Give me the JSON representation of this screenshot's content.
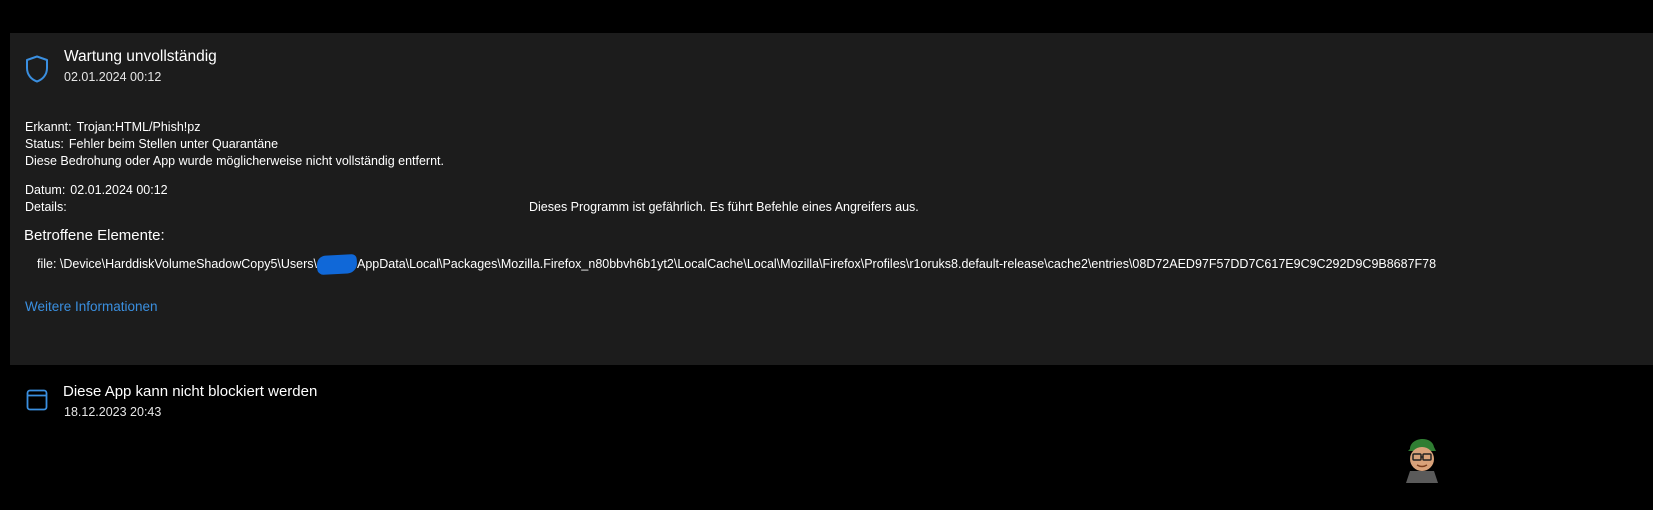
{
  "colors": {
    "background": "#000000",
    "panel": "#1c1c1c",
    "accent": "#3a8fe0",
    "redaction": "#1068d8"
  },
  "threat": {
    "icon": "shield-icon",
    "title": "Wartung unvollständig",
    "timestamp": "02.01.2024 00:12",
    "detected_label": "Erkannt:",
    "detected_value": "Trojan:HTML/Phish!pz",
    "status_label": "Status:",
    "status_value": "Fehler beim Stellen unter Quarantäne",
    "note": "Diese Bedrohung oder App wurde möglicherweise nicht vollständig entfernt.",
    "date_label": "Datum:",
    "date_value": "02.01.2024 00:12",
    "details_label": "Details:",
    "details_value": "Dieses Programm ist gefährlich. Es führt Befehle eines Angreifers aus.",
    "affected_heading": "Betroffene Elemente:",
    "file_path_prefix": "file: \\Device\\HarddiskVolumeShadowCopy5\\Users\\",
    "file_path_suffix": "AppData\\Local\\Packages\\Mozilla.Firefox_n80bbvh6b1yt2\\LocalCache\\Local\\Mozilla\\Firefox\\Profiles\\r1oruks8.default-release\\cache2\\entries\\08D72AED97F57DD7C617E9C9C292D9C9B8687F78",
    "more_info_link": "Weitere Informationen"
  },
  "second_item": {
    "icon": "app-window-icon",
    "title": "Diese App kann nicht blockiert werden",
    "timestamp": "18.12.2023 20:43"
  },
  "watermark": {
    "icon": "appuals-mascot-logo"
  }
}
